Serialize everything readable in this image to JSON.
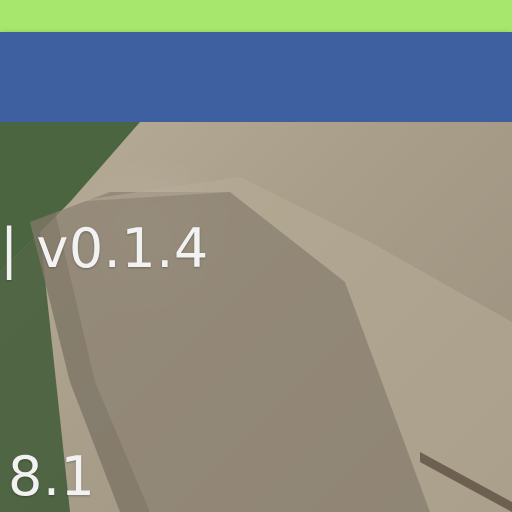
{
  "overlay": {
    "version_text": "| v0.1.4",
    "number_text": "8.1"
  },
  "colors": {
    "top_strip": "#a7e76d",
    "app_bar": "#3f60a0",
    "text": "#f2f2f2"
  }
}
